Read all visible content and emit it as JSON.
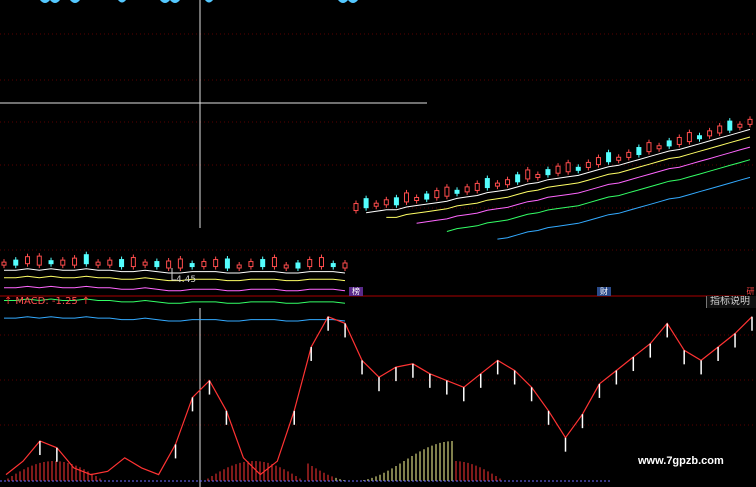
{
  "macd": {
    "label": "MACD: -1.25",
    "arrow_left": "↑",
    "arrow_right": "↑"
  },
  "help_button": {
    "label": "指标说明"
  },
  "price_marker": {
    "label": "4.45"
  },
  "event_tags": [
    {
      "label": "榜"
    },
    {
      "label": "财"
    },
    {
      "label": "研"
    }
  ],
  "watermark": {
    "text": "www.7gpzb.com"
  },
  "colors": {
    "up": "#ff4d4d",
    "down": "#54ffff",
    "macd_line": "#ff3333",
    "bar_yellow": "#ffff99",
    "bar_red": "#ff3333"
  },
  "chart_data": [
    {
      "type": "candlestick",
      "panel": "price",
      "note_series": "open/close relative trend; y grows upward",
      "values": [
        2,
        2,
        3,
        2,
        3,
        2,
        2,
        3,
        2,
        2,
        1,
        1,
        2,
        1,
        0,
        0,
        1,
        1,
        1,
        0,
        0,
        1,
        1,
        1,
        0,
        0,
        1,
        1,
        1,
        0,
        40,
        42,
        43,
        44,
        44,
        46,
        47,
        48,
        49,
        50,
        52,
        53,
        54,
        56,
        57,
        58,
        60,
        62,
        63,
        65,
        66,
        67,
        68,
        70,
        72,
        74,
        75,
        77,
        79,
        81,
        83,
        85,
        86,
        88,
        90,
        92,
        94,
        96,
        98,
        100
      ],
      "ylim": [
        0,
        110
      ]
    },
    {
      "type": "line",
      "panel": "macd",
      "values": [
        2,
        10,
        22,
        18,
        6,
        2,
        4,
        12,
        6,
        2,
        20,
        48,
        58,
        40,
        12,
        2,
        10,
        40,
        78,
        96,
        92,
        70,
        60,
        66,
        68,
        62,
        58,
        54,
        62,
        70,
        64,
        54,
        40,
        24,
        38,
        56,
        64,
        72,
        80,
        92,
        76,
        70,
        78,
        86,
        96
      ],
      "ylim": [
        0,
        100
      ]
    }
  ]
}
